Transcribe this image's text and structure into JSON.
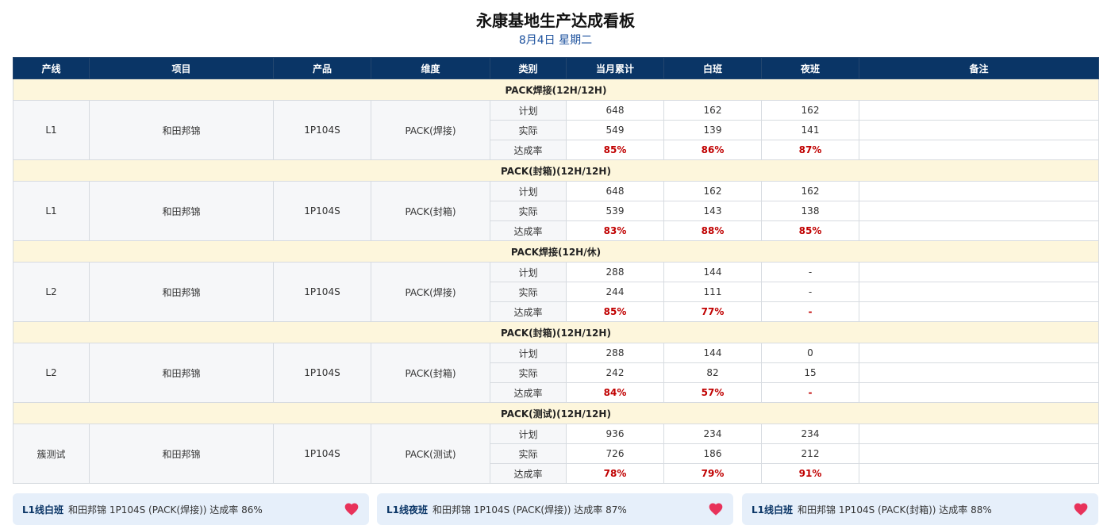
{
  "header": {
    "title": "永康基地生产达成看板",
    "subtitle": "8月4日 星期二"
  },
  "columns": [
    "产线",
    "项目",
    "产品",
    "维度",
    "类别",
    "当月累计",
    "白班",
    "夜班",
    "备注"
  ],
  "sections": [
    {
      "title": "PACK焊接(12H/12H)",
      "line": "L1",
      "project": "和田邦锦",
      "product": "1P104S",
      "dimension": "PACK(焊接)",
      "rows": [
        {
          "category": "计划",
          "month": "648",
          "day": "162",
          "night": "162",
          "note": "",
          "rate": false
        },
        {
          "category": "实际",
          "month": "549",
          "day": "139",
          "night": "141",
          "note": "",
          "rate": false
        },
        {
          "category": "达成率",
          "month": "85%",
          "day": "86%",
          "night": "87%",
          "note": "",
          "rate": true
        }
      ]
    },
    {
      "title": "PACK(封箱)(12H/12H)",
      "line": "L1",
      "project": "和田邦锦",
      "product": "1P104S",
      "dimension": "PACK(封箱)",
      "rows": [
        {
          "category": "计划",
          "month": "648",
          "day": "162",
          "night": "162",
          "note": "",
          "rate": false
        },
        {
          "category": "实际",
          "month": "539",
          "day": "143",
          "night": "138",
          "note": "",
          "rate": false
        },
        {
          "category": "达成率",
          "month": "83%",
          "day": "88%",
          "night": "85%",
          "note": "",
          "rate": true
        }
      ]
    },
    {
      "title": "PACK焊接(12H/休)",
      "line": "L2",
      "project": "和田邦锦",
      "product": "1P104S",
      "dimension": "PACK(焊接)",
      "rows": [
        {
          "category": "计划",
          "month": "288",
          "day": "144",
          "night": "-",
          "note": "",
          "rate": false
        },
        {
          "category": "实际",
          "month": "244",
          "day": "111",
          "night": "-",
          "note": "",
          "rate": false
        },
        {
          "category": "达成率",
          "month": "85%",
          "day": "77%",
          "night": "-",
          "note": "",
          "rate": true
        }
      ]
    },
    {
      "title": "PACK(封箱)(12H/12H)",
      "line": "L2",
      "project": "和田邦锦",
      "product": "1P104S",
      "dimension": "PACK(封箱)",
      "rows": [
        {
          "category": "计划",
          "month": "288",
          "day": "144",
          "night": "0",
          "note": "",
          "rate": false
        },
        {
          "category": "实际",
          "month": "242",
          "day": "82",
          "night": "15",
          "note": "",
          "rate": false
        },
        {
          "category": "达成率",
          "month": "84%",
          "day": "57%",
          "night": "-",
          "note": "",
          "rate": true
        }
      ]
    },
    {
      "title": "PACK(测试)(12H/12H)",
      "line": "簇测试",
      "project": "和田邦锦",
      "product": "1P104S",
      "dimension": "PACK(测试)",
      "rows": [
        {
          "category": "计划",
          "month": "936",
          "day": "234",
          "night": "234",
          "note": "",
          "rate": false
        },
        {
          "category": "实际",
          "month": "726",
          "day": "186",
          "night": "212",
          "note": "",
          "rate": false
        },
        {
          "category": "达成率",
          "month": "78%",
          "day": "79%",
          "night": "91%",
          "note": "",
          "rate": true
        }
      ]
    }
  ],
  "cards": [
    {
      "shift": "L1线白班",
      "text": "和田邦锦 1P104S (PACK(焊接)) 达成率 86%",
      "icon": "heart-icon"
    },
    {
      "shift": "L1线夜班",
      "text": "和田邦锦 1P104S (PACK(焊接)) 达成率 87%",
      "icon": "heart-icon"
    },
    {
      "shift": "L1线白班",
      "text": "和田邦锦 1P104S (PACK(封箱)) 达成率 88%",
      "icon": "heart-icon"
    }
  ],
  "colors": {
    "header_bg": "#0a3566",
    "section_bg": "#fdf6dc",
    "rate_red": "#c00000",
    "card_bg": "#e6effa",
    "heart": "#e8325a"
  }
}
